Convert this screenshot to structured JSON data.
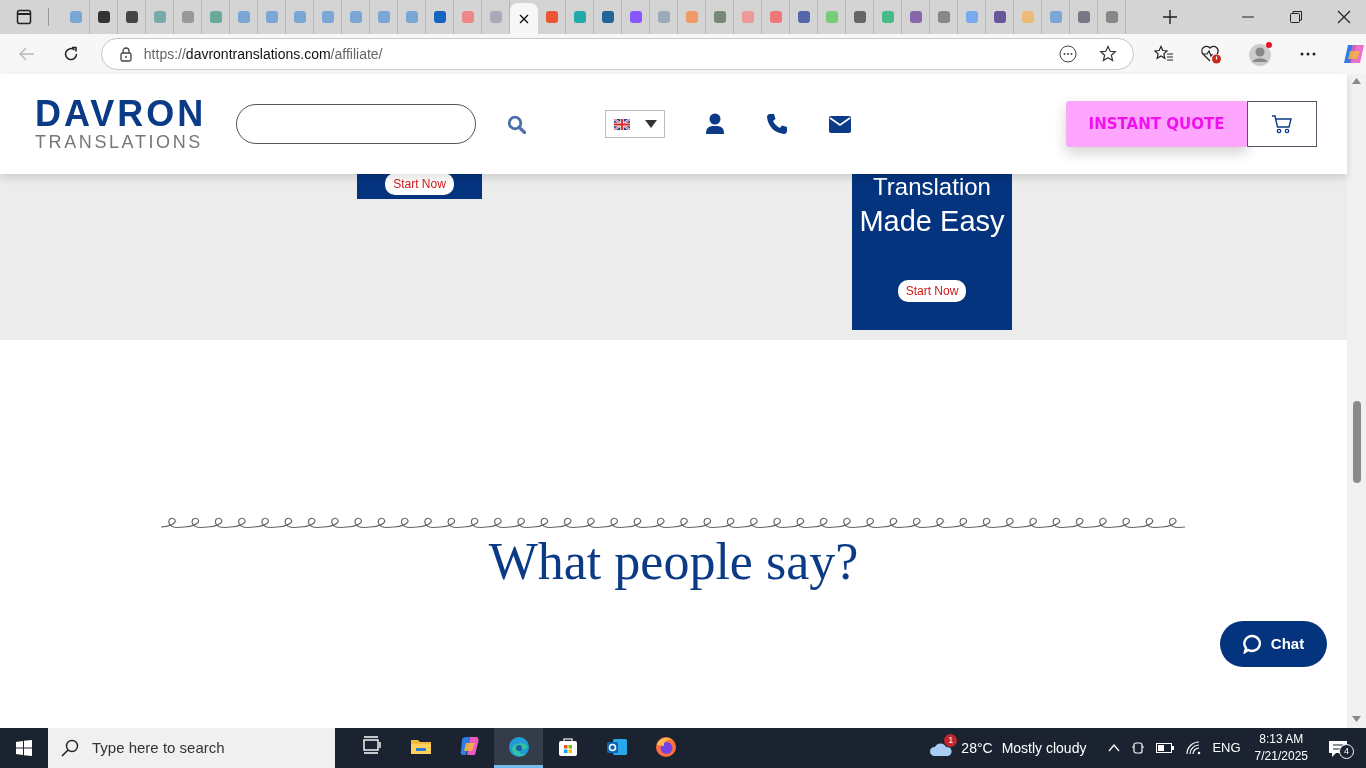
{
  "browser": {
    "tabs": [
      {
        "selected": false
      },
      {
        "selected": false
      },
      {
        "selected": false
      },
      {
        "selected": false
      },
      {
        "selected": false
      },
      {
        "selected": false
      },
      {
        "selected": false
      },
      {
        "selected": false
      },
      {
        "selected": false
      },
      {
        "selected": false
      },
      {
        "selected": false
      },
      {
        "selected": false
      },
      {
        "selected": false
      },
      {
        "selected": false
      },
      {
        "selected": false
      },
      {
        "selected": false
      },
      {
        "selected": true
      },
      {
        "selected": false
      },
      {
        "selected": false
      },
      {
        "selected": false
      },
      {
        "selected": false
      },
      {
        "selected": false
      },
      {
        "selected": false
      },
      {
        "selected": false
      },
      {
        "selected": false
      },
      {
        "selected": false
      },
      {
        "selected": false
      },
      {
        "selected": false
      },
      {
        "selected": false
      },
      {
        "selected": false
      },
      {
        "selected": false
      },
      {
        "selected": false
      },
      {
        "selected": false
      },
      {
        "selected": false
      },
      {
        "selected": false
      },
      {
        "selected": false
      },
      {
        "selected": false
      },
      {
        "selected": false
      }
    ],
    "address_bar": {
      "scheme": "https://",
      "host": "davrontranslations.com",
      "path": "/affiliate/"
    }
  },
  "header": {
    "logo": {
      "line1": "DAVRON",
      "line2": "TRANSLATIONS"
    },
    "quote_button": "INSTANT QUOTE"
  },
  "banners": [
    {
      "button": "Start Now"
    },
    {
      "lines": [
        "Translation",
        "Made Easy"
      ],
      "button": "Start Now"
    }
  ],
  "section": {
    "heading": "What people say?"
  },
  "chat_button": "Chat",
  "taskbar": {
    "search_placeholder": "Type here to search",
    "apps": [
      {
        "kind": "taskview",
        "selected": false
      },
      {
        "kind": "folder",
        "selected": false
      },
      {
        "kind": "copilot",
        "selected": false
      },
      {
        "kind": "edge",
        "selected": true
      },
      {
        "kind": "store",
        "selected": false
      },
      {
        "kind": "outlook",
        "selected": false
      },
      {
        "kind": "firefox",
        "selected": false
      }
    ],
    "weather": {
      "badge": "1",
      "temperature": "28°C",
      "condition": "Mostly cloudy"
    },
    "language": "ENG",
    "time": "8:13 AM",
    "date": "7/21/2025",
    "notifications": "4"
  }
}
